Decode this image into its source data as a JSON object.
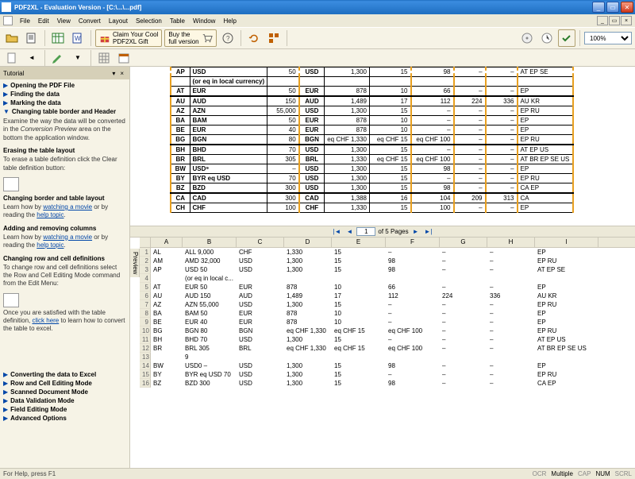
{
  "window": {
    "title": "PDF2XL - Evaluation Version - [C:\\...\\...pdf]"
  },
  "menu": [
    "File",
    "Edit",
    "View",
    "Convert",
    "Layout",
    "Selection",
    "Table",
    "Window",
    "Help"
  ],
  "toolbar": {
    "promo1_line1": "Claim Your Cool",
    "promo1_line2": "PDF2XL Gift",
    "promo2_line1": "Buy the",
    "promo2_line2": "full version",
    "zoom": "100%"
  },
  "tutorial": {
    "title": "Tutorial",
    "items_top": [
      "Opening the PDF File",
      "Finding the data",
      "Marking the data"
    ],
    "sec1_title": "Changing table border and Header",
    "sec1_text": "Examine the way the data will be converted in the Conversion Preview area on the bottom the application window.",
    "sec2_title": "Erasing the table layout",
    "sec2_text": "To erase a table definition click the Clear table definition button:",
    "sec3_title": "Changing border and table layout",
    "sec3_text": "Learn how by watching a movie or by reading the help topic.",
    "sec4_title": "Adding and removing columns",
    "sec4_text": "Learn how by watching a movie or by reading the help topic.",
    "sec5_title": "Changing row and cell definitions",
    "sec5_text": "To change row and cell definitions select the Row and Cell Editing Mode command from the Edit Menu:",
    "sec6_text": "Once you are satisfied with the table definition, click here to learn how to convert the table to excel.",
    "items_bottom": [
      "Converting the data to Excel",
      "Row and Cell Editing Mode",
      "Scanned Document Mode",
      "Data Validation Mode",
      "Field Editing Mode",
      "Advanced Options"
    ]
  },
  "doc_rows": [
    {
      "c0": "AP",
      "c1": "USD",
      "c2": "50",
      "c3": "USD",
      "c4": "1,300",
      "c5": "15",
      "c6": "98",
      "c7": "–",
      "c8": "–",
      "c9": "AT EP SE",
      "sep": false
    },
    {
      "c0": "",
      "c1": "(or eq in local currency)",
      "c2": "",
      "c3": "",
      "c4": "",
      "c5": "",
      "c6": "",
      "c7": "",
      "c8": "",
      "c9": "",
      "sep": false
    },
    {
      "c0": "AT",
      "c1": "EUR",
      "c2": "50",
      "c3": "EUR",
      "c4": "878",
      "c5": "10",
      "c6": "66",
      "c7": "–",
      "c8": "–",
      "c9": "EP",
      "sep": false
    },
    {
      "c0": "AU",
      "c1": "AUD",
      "c2": "150",
      "c3": "AUD",
      "c4": "1,489",
      "c5": "17",
      "c6": "112",
      "c7": "224",
      "c8": "336",
      "c9": "AU KR",
      "sep": true
    },
    {
      "c0": "AZ",
      "c1": "AZN",
      "c2": "55,000",
      "c3": "USD",
      "c4": "1,300",
      "c5": "15",
      "c6": "–",
      "c7": "–",
      "c8": "–",
      "c9": "EP RU",
      "sep": false
    },
    {
      "c0": "BA",
      "c1": "BAM",
      "c2": "50",
      "c3": "EUR",
      "c4": "878",
      "c5": "10",
      "c6": "–",
      "c7": "–",
      "c8": "–",
      "c9": "EP",
      "sep": false
    },
    {
      "c0": "BE",
      "c1": "EUR",
      "c2": "40",
      "c3": "EUR",
      "c4": "878",
      "c5": "10",
      "c6": "–",
      "c7": "–",
      "c8": "–",
      "c9": "EP",
      "sep": false
    },
    {
      "c0": "BG",
      "c1": "BGN",
      "c2": "80",
      "c3": "BGN",
      "c4": "eq CHF 1,330",
      "c5": "eq CHF 15",
      "c6": "eq CHF 100",
      "c7": "–",
      "c8": "–",
      "c9": "EP RU",
      "sep": false
    },
    {
      "c0": "BH",
      "c1": "BHD",
      "c2": "70",
      "c3": "USD",
      "c4": "1,300",
      "c5": "15",
      "c6": "–",
      "c7": "–",
      "c8": "–",
      "c9": "AT EP US",
      "sep": true
    },
    {
      "c0": "BR",
      "c1": "BRL",
      "c2": "305",
      "c3": "BRL",
      "c4": "1,330",
      "c5": "eq CHF 15",
      "c6": "eq CHF 100",
      "c7": "–",
      "c8": "–",
      "c9": "AT BR EP SE US",
      "sep": false
    },
    {
      "c0": "BW",
      "c1": "USD⁹",
      "c2": "–",
      "c3": "USD",
      "c4": "1,300",
      "c5": "15",
      "c6": "98",
      "c7": "–",
      "c8": "–",
      "c9": "EP",
      "sep": false
    },
    {
      "c0": "BY",
      "c1": "BYR eq USD",
      "c2": "70",
      "c3": "USD",
      "c4": "1,300",
      "c5": "15",
      "c6": "–",
      "c7": "–",
      "c8": "–",
      "c9": "EP RU",
      "sep": false
    },
    {
      "c0": "BZ",
      "c1": "BZD",
      "c2": "300",
      "c3": "USD",
      "c4": "1,300",
      "c5": "15",
      "c6": "98",
      "c7": "–",
      "c8": "–",
      "c9": "CA EP",
      "sep": false
    },
    {
      "c0": "CA",
      "c1": "CAD",
      "c2": "300",
      "c3": "CAD",
      "c4": "1,388",
      "c5": "16",
      "c6": "104",
      "c7": "209",
      "c8": "313",
      "c9": "CA",
      "sep": true
    },
    {
      "c0": "CH",
      "c1": "CHF",
      "c2": "100",
      "c3": "CHF",
      "c4": "1,330",
      "c5": "15",
      "c6": "100",
      "c7": "–",
      "c8": "–",
      "c9": "EP",
      "sep": false
    }
  ],
  "pager": {
    "current": "1",
    "of": "of 5 Pages"
  },
  "preview_cols": [
    "A",
    "B",
    "C",
    "D",
    "E",
    "F",
    "G",
    "H",
    "I"
  ],
  "preview_rows": [
    {
      "n": "1",
      "A": "AL",
      "B": "ALL 9,000",
      "C": "CHF",
      "D": "1,330",
      "E": "15",
      "F": "–",
      "G": "–",
      "H": "–",
      "I": "EP"
    },
    {
      "n": "2",
      "A": "AM",
      "B": "AMD 32,000",
      "C": "USD",
      "D": "1,300",
      "E": "15",
      "F": "98",
      "G": "–",
      "H": "–",
      "I": "EP RU"
    },
    {
      "n": "3",
      "A": "AP",
      "B": "USD 50",
      "C": "USD",
      "D": "1,300",
      "E": "15",
      "F": "98",
      "G": "–",
      "H": "–",
      "I": "AT EP SE"
    },
    {
      "n": "4",
      "A": "",
      "B": "(or eq in local c...",
      "C": "",
      "D": "",
      "E": "",
      "F": "",
      "G": "",
      "H": "",
      "I": ""
    },
    {
      "n": "5",
      "A": "AT",
      "B": "EUR 50",
      "C": "EUR",
      "D": "878",
      "E": "10",
      "F": "66",
      "G": "–",
      "H": "–",
      "I": "EP"
    },
    {
      "n": "6",
      "A": "AU",
      "B": "AUD 150",
      "C": "AUD",
      "D": "1,489",
      "E": "17",
      "F": "112",
      "G": "224",
      "H": "336",
      "I": "AU KR"
    },
    {
      "n": "7",
      "A": "AZ",
      "B": "AZN 55,000",
      "C": "USD",
      "D": "1,300",
      "E": "15",
      "F": "–",
      "G": "–",
      "H": "–",
      "I": "EP RU"
    },
    {
      "n": "8",
      "A": "BA",
      "B": "BAM 50",
      "C": "EUR",
      "D": "878",
      "E": "10",
      "F": "–",
      "G": "–",
      "H": "–",
      "I": "EP"
    },
    {
      "n": "9",
      "A": "BE",
      "B": "EUR 40",
      "C": "EUR",
      "D": "878",
      "E": "10",
      "F": "–",
      "G": "–",
      "H": "–",
      "I": "EP"
    },
    {
      "n": "10",
      "A": "BG",
      "B": "BGN 80",
      "C": "BGN",
      "D": "eq CHF 1,330",
      "E": "eq CHF 15",
      "F": "eq CHF 100",
      "G": "–",
      "H": "–",
      "I": "EP RU"
    },
    {
      "n": "11",
      "A": "BH",
      "B": "BHD 70",
      "C": "USD",
      "D": "1,300",
      "E": "15",
      "F": "–",
      "G": "–",
      "H": "–",
      "I": "AT EP US"
    },
    {
      "n": "12",
      "A": "BR",
      "B": "BRL 305",
      "C": "BRL",
      "D": "eq CHF 1,330",
      "E": "eq CHF 15",
      "F": "eq CHF 100",
      "G": "–",
      "H": "–",
      "I": "AT BR EP SE US"
    },
    {
      "n": "13",
      "A": "",
      "B": "9",
      "C": "",
      "D": "",
      "E": "",
      "F": "",
      "G": "",
      "H": "",
      "I": ""
    },
    {
      "n": "14",
      "A": "BW",
      "B": "USD0 –",
      "C": "USD",
      "D": "1,300",
      "E": "15",
      "F": "98",
      "G": "–",
      "H": "–",
      "I": "EP"
    },
    {
      "n": "15",
      "A": "BY",
      "B": "BYR eq USD 70",
      "C": "USD",
      "D": "1,300",
      "E": "15",
      "F": "–",
      "G": "–",
      "H": "–",
      "I": "EP RU"
    },
    {
      "n": "16",
      "A": "BZ",
      "B": "BZD 300",
      "C": "USD",
      "D": "1,300",
      "E": "15",
      "F": "98",
      "G": "–",
      "H": "–",
      "I": "CA EP"
    }
  ],
  "preview_tab": "Preview",
  "status": {
    "help": "For Help, press F1",
    "ocr": "OCR",
    "multiple": "Multiple",
    "cap": "CAP",
    "num": "NUM",
    "scrl": "SCRL"
  }
}
